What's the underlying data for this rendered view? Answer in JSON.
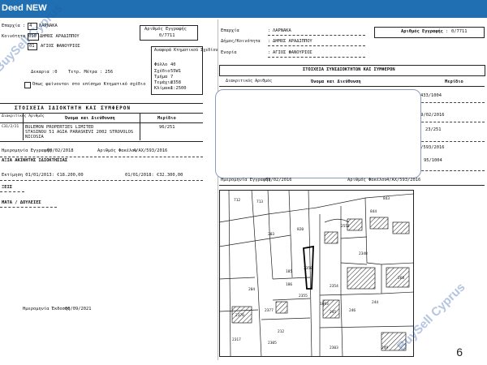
{
  "header": {
    "title": "Deed NEW"
  },
  "left_doc": {
    "district_no": "4",
    "district_name": "ΛΑΡΝΑΚΑ",
    "municipality_label": "Κοινότητα",
    "municipality_code": "010",
    "municipality_name": "ΔΗΜΟΣ ΑΡΑΔΙΠΠΟΥ",
    "quarter_code": "01",
    "quarter_name": "ΑΓΙΟΣ ΦΑΝΟΥΡΙΟΣ",
    "registration_label": "Αριθμός Εγγραφής",
    "registration_no": "0/7711",
    "ref_label": "Αναφορά Κτηματικού Σχεδίου",
    "sheet_label": "Φύλλο",
    "sheet_value": "40",
    "plan_label": "Σχέδιο",
    "plan_value": "55W1",
    "block_label": "Τμήμα",
    "block_value": "7",
    "plot_label": "Τεμάχιο",
    "plot_value": "2358",
    "scale_label": "Κλίμακα",
    "scale_value": "1:2500",
    "area_line_a": "Δεκαρια :0",
    "area_line_b": "Τετρ. Μέτρα : 256",
    "shown_line": "Όπως φαίνονται στο επίσημο Κτηματικό σχέδιο",
    "owners_title": "ΣΤΟΙΧΕΙΑ ΙΔΙΟΚΤΗΤΗ ΚΑΙ ΣΥΜΦΕΡΟΝ",
    "col_id": "Διακριτικός Αριθμός",
    "col_name": "Όνομα και Διεύθυνση",
    "col_share": "Μερίδιο",
    "owner_id": "C31/2/21",
    "owner_name_1": "BULEMON PROPERTIES LIMITED",
    "owner_name_2": "STASINOU 51 AGIA PARASKEVI 2002 STROVOLOS",
    "owner_name_3": "NICOSIA",
    "owner_share": "96/251",
    "reg_date_label": "Ημερομηνία Εγγραφής",
    "reg_date_value": "09/02/2018",
    "file_label": "Αριθμός Φακέλου",
    "file_value": "4/ΑΧ/593/2016",
    "property_values_title": "ΑΞΙΑ ΑΚΙΝΗΤΗΣ ΙΔΙΟΚΤΗΣΙΑΣ",
    "val_2013": "Εκτίμηση 01/01/2013: €18.200,00",
    "val_2018": "01/01/2018: €32.300,00",
    "notes_1": "ΞΕΙΣ",
    "notes_2": "ΜΑΤΑ / ΔΟΥΛΕΙΕΣ",
    "issue_date_label": "Ημερομηνία Έκδοσης",
    "issue_date_value": "06/09/2021"
  },
  "right_doc": {
    "province_label": "Επαρχία",
    "province_value": "ΛΑΡΝΑΚΑ",
    "municipality_label": "Δήμος/Κοινότητα",
    "municipality_value": "ΔΗΜΟΣ ΑΡΑΔΙΠΠΟΥ",
    "quarter_label": "Ενορία",
    "quarter_value": "ΑΓΙΟΣ ΦΑΝΟΥΡΙΟΣ",
    "registration_label": "Αριθμός Εγγραφής",
    "registration_value": "0/7711",
    "owners_title": "ΣΤΟΙΧΕΙΑ ΣΥΝΙΔΙΟΚΤΗΤΩΝ ΚΑΙ ΣΥΜΦΕΡΟΝ",
    "col_id": "Διακριτικός Αριθμός",
    "col_name": "Όνομα και Διεύθυνση",
    "col_share": "Μερίδιο",
    "rows": [
      {
        "date": "09/02/2016",
        "share": "433/1004"
      },
      {
        "date": "09/02/2016",
        "share": "23/251"
      },
      {
        "date": "2/593/2016",
        "share": "95/1004"
      }
    ],
    "reg_date_label": "Ημερομηνία Εγγραφής",
    "reg_date_value": "09/02/2016",
    "file_label": "Αριθμός Φακέλου",
    "file_value": "4/ΑΧ/593/2016"
  },
  "map": {
    "plot_numbers": [
      "712",
      "713",
      "2551",
      "820",
      "2358",
      "2348",
      "203",
      "843",
      "844",
      "185",
      "186",
      "2354",
      "1093",
      "2355",
      "246",
      "245",
      "244",
      "204",
      "212",
      "2377",
      "2378",
      "268",
      "2305",
      "2317",
      "2303",
      "249"
    ]
  },
  "watermark": {
    "text": "BuySell Cyprus"
  },
  "page_number": "6"
}
